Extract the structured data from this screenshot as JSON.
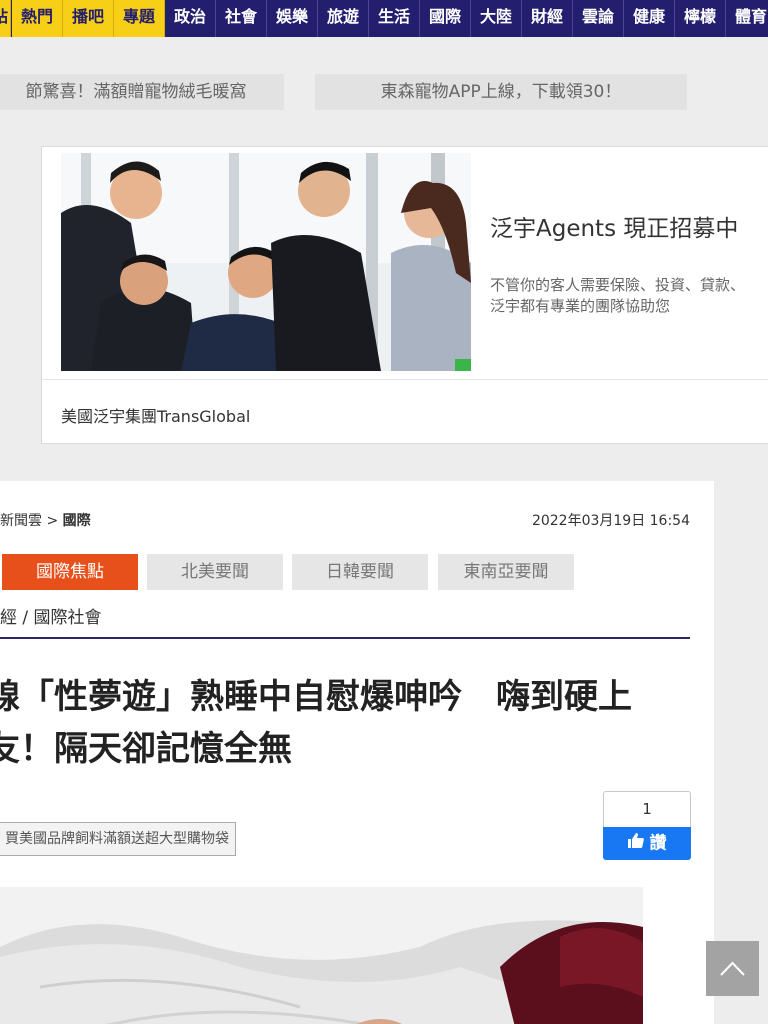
{
  "nav": {
    "items": [
      {
        "label": "站",
        "hot": true
      },
      {
        "label": "熱門",
        "hot": true
      },
      {
        "label": "播吧",
        "hot": true
      },
      {
        "label": "專題",
        "hot": true
      },
      {
        "label": "政治",
        "hot": false
      },
      {
        "label": "社會",
        "hot": false
      },
      {
        "label": "娛樂",
        "hot": false
      },
      {
        "label": "旅遊",
        "hot": false
      },
      {
        "label": "生活",
        "hot": false
      },
      {
        "label": "國際",
        "hot": false
      },
      {
        "label": "大陸",
        "hot": false
      },
      {
        "label": "財經",
        "hot": false
      },
      {
        "label": "雲論",
        "hot": false
      },
      {
        "label": "健康",
        "hot": false
      },
      {
        "label": "檸檬",
        "hot": false
      },
      {
        "label": "體育",
        "hot": false
      }
    ]
  },
  "promos": [
    "節驚喜！滿額贈寵物絨毛暖窩",
    "東森寵物APP上線，下載領30！"
  ],
  "ad": {
    "title": "泛宇Agents 現正招募中",
    "desc_line1": "不管你的客人需要保險、投資、貸款、",
    "desc_line2": "泛宇都有專業的團隊協助您",
    "advertiser": "美國泛宇集團TransGlobal"
  },
  "article": {
    "breadcrumb_root": "新聞雲",
    "breadcrumb_sep": " > ",
    "breadcrumb_current": "國際",
    "date": "2022年03月19日 16:54",
    "subtabs": [
      "國際焦點",
      "北美要聞",
      "日韓要聞",
      "東南亞要聞"
    ],
    "category": "經 / 國際社會",
    "headline_line1": "線「性夢遊」熟睡中自慰爆呻吟　嗨到硬上",
    "headline_line2": "友！隔天卻記憶全無",
    "ad_tag": "買美國品牌飼料滿額送超大型購物袋",
    "likes": "1",
    "like_label": "讚"
  },
  "colors": {
    "nav_bg": "#231e6e",
    "nav_hot": "#f7cf17",
    "accent_orange": "#e8501b",
    "fb_blue": "#1877f2"
  },
  "icons": [
    "thumbs-up-icon",
    "chevron-up-icon"
  ]
}
